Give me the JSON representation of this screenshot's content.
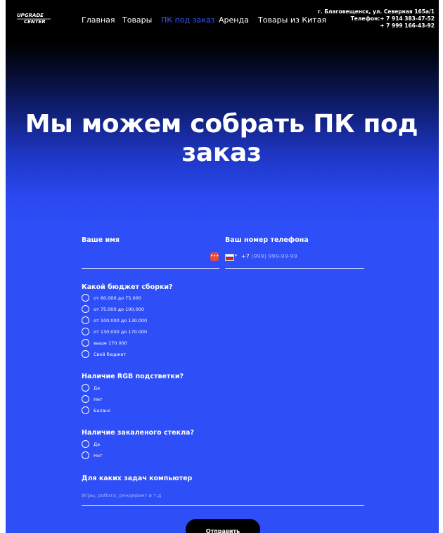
{
  "header": {
    "logo_text": "UPGRADE CENTER",
    "nav": [
      {
        "label": "Главная",
        "active": false
      },
      {
        "label": "Товары",
        "active": false
      },
      {
        "label": "ПК под заказ",
        "active": true
      },
      {
        "label": "Аренда",
        "active": false
      },
      {
        "label": "Товары из Китая",
        "active": false
      }
    ],
    "contacts": {
      "address": "г. Благовещенск, ул. Северная 165а/1",
      "phone1": "Телефон:+ 7 914 383-47-52",
      "phone2": "+ 7 999 166-43-92"
    }
  },
  "hero": {
    "title": "Мы можем собрать ПК под заказ"
  },
  "form": {
    "name_label": "Ваше имя",
    "phone_label": "Ваш номер телефона",
    "phone_prefix": "+7",
    "phone_placeholder": "(999) 999-99-99",
    "autofill_badge": "•••",
    "budget": {
      "question": "Какой бюджет сборки?",
      "options": [
        "от 60.000 до 75.000",
        "от 75.000 до 100.000",
        "от 100.000 до 130.000",
        "от 130.000 до 170.000",
        "выше 170.000",
        "Свой бюджет"
      ]
    },
    "rgb": {
      "question": "Наличие RGB подстветки?",
      "options": [
        "Да",
        "Нет",
        "Баланс"
      ]
    },
    "glass": {
      "question": "Наличие закаленого стекла?",
      "options": [
        "Да",
        "Нет"
      ]
    },
    "tasks": {
      "question": "Для каких задач компьютер",
      "placeholder": "Игры, робота, рендеринг и т.д"
    },
    "submit_label": "Отправить"
  },
  "colors": {
    "accent": "#2e4ef7",
    "active_nav": "#3a5aff",
    "badge": "#e74c3c"
  }
}
